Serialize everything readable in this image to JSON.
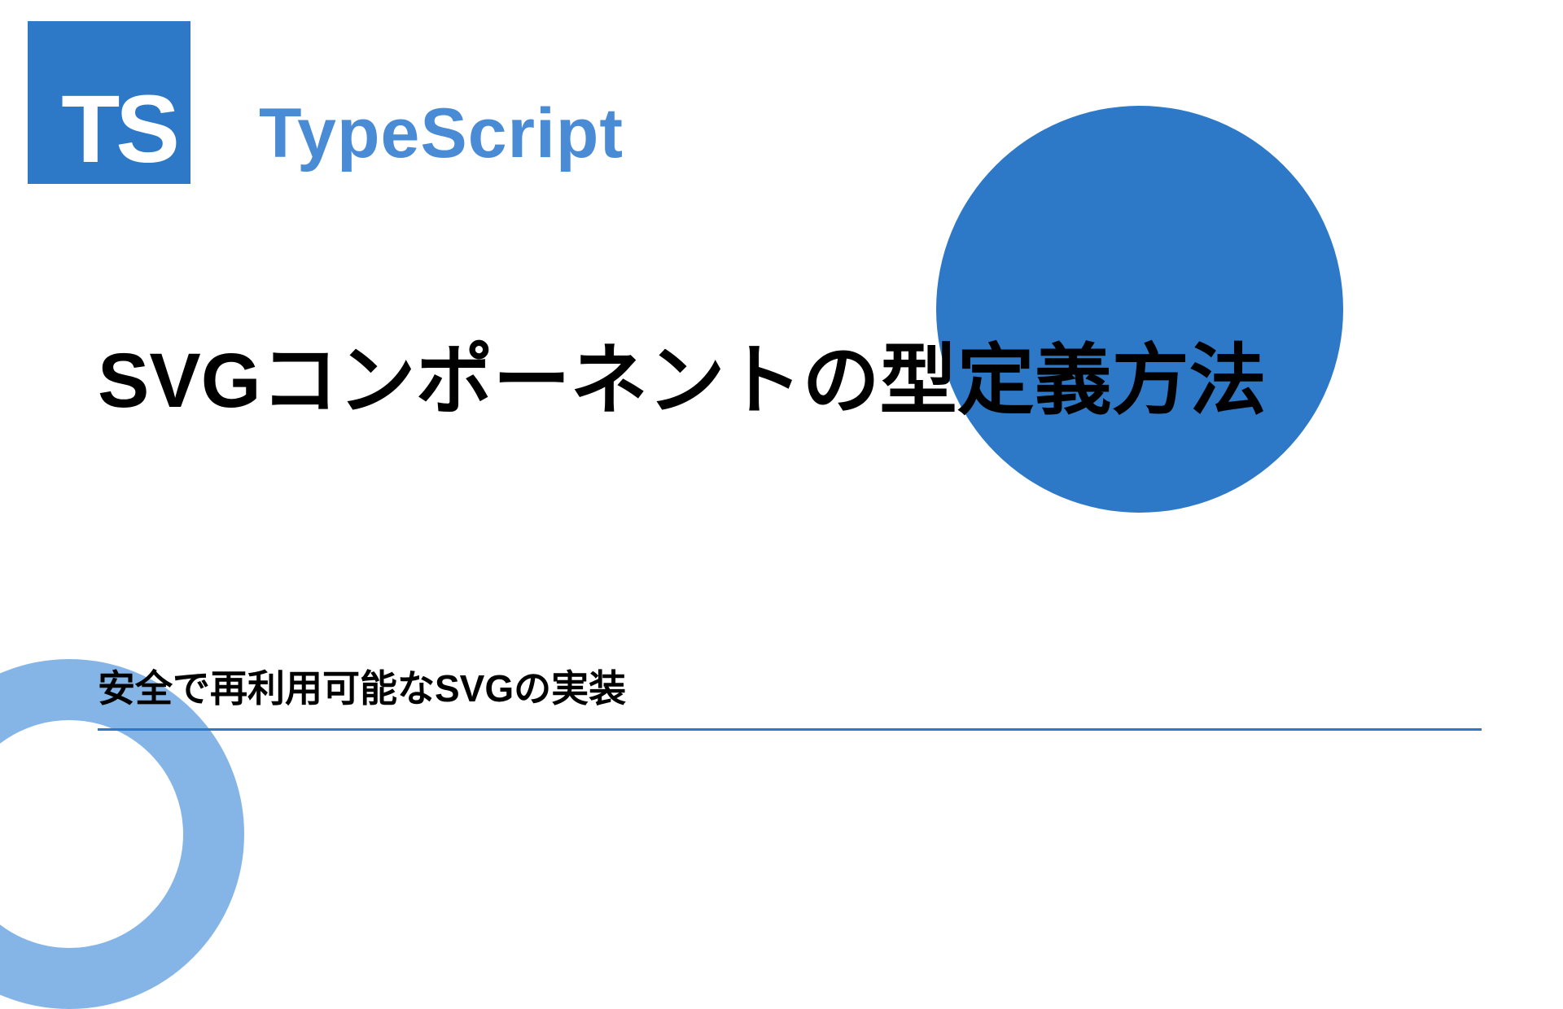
{
  "logo": {
    "text": "TS"
  },
  "header": {
    "language_label": "TypeScript"
  },
  "content": {
    "title": "SVGコンポーネントの型定義方法",
    "subtitle": "安全で再利用可能なSVGの実装"
  },
  "colors": {
    "primary": "#2d79c7",
    "accent": "#6fa8e2"
  }
}
